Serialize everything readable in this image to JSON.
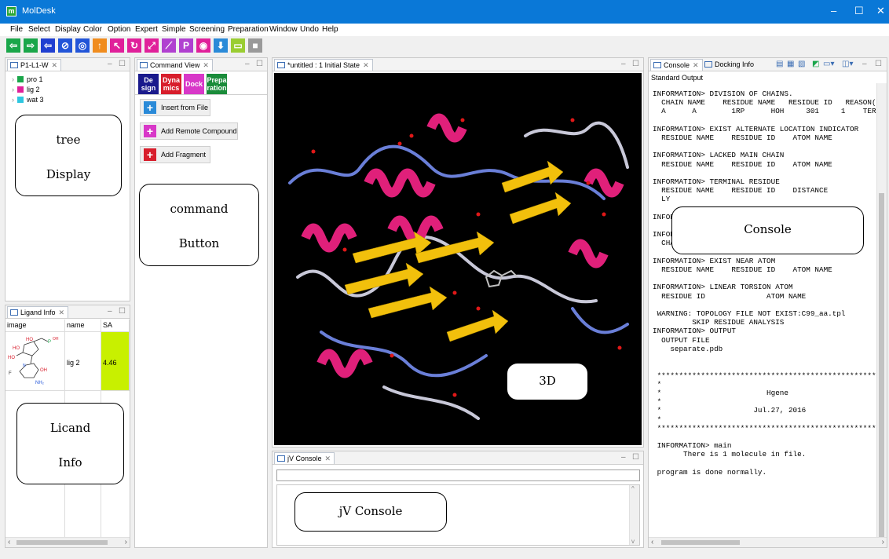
{
  "window": {
    "title": "MolDesk",
    "app_icon": "m",
    "minimize": "–",
    "maximize": "☐",
    "close": "✕"
  },
  "menu": [
    "File",
    "Select",
    "Display",
    "Color",
    "Option",
    "Expert",
    "Simple",
    "Screening",
    "Preparation",
    "Window",
    "Undo",
    "Help"
  ],
  "toolbar": {
    "buttons": [
      {
        "name": "back-arrow-icon",
        "glyph": "⇦",
        "color": "#1aa64a"
      },
      {
        "name": "forward-arrow-icon",
        "glyph": "⇨",
        "color": "#1aa64a"
      },
      {
        "name": "back-blue-icon",
        "glyph": "⇦",
        "color": "#1f3fd1"
      },
      {
        "name": "cancel-icon",
        "glyph": "⊘",
        "color": "#2255d8"
      },
      {
        "name": "target-icon",
        "glyph": "◎",
        "color": "#2255d8"
      },
      {
        "name": "up-arrow-icon",
        "glyph": "↑",
        "color": "#f08c1e"
      },
      {
        "name": "select-cursor-icon",
        "glyph": "↖",
        "color": "#e0209a"
      },
      {
        "name": "rotate-icon",
        "glyph": "↻",
        "color": "#e0209a"
      },
      {
        "name": "expand-icon",
        "glyph": "⤢",
        "color": "#e0209a"
      },
      {
        "name": "feather-icon",
        "glyph": "⟋",
        "color": "#b040d0"
      },
      {
        "name": "ruler-icon",
        "glyph": "P",
        "color": "#b040d0"
      },
      {
        "name": "eye-icon",
        "glyph": "◉",
        "color": "#e0209a"
      },
      {
        "name": "download-icon",
        "glyph": "⬇",
        "color": "#2a8ad8"
      },
      {
        "name": "monitor-icon",
        "glyph": "▭",
        "color": "#9acd32"
      },
      {
        "name": "stop-icon",
        "glyph": "■",
        "color": "#9a9a9a"
      }
    ]
  },
  "tree_panel": {
    "tab": "P1-L1-W",
    "items": [
      {
        "label": "pro 1",
        "color": "#1aa64a"
      },
      {
        "label": "lig 2",
        "color": "#e0209a"
      },
      {
        "label": "wat 3",
        "color": "#2ec6e0"
      }
    ],
    "callout": [
      "tree",
      "Display"
    ]
  },
  "ligand_panel": {
    "tab": "Ligand Info",
    "columns": [
      "image",
      "name",
      "SA"
    ],
    "rows": [
      {
        "name": "lig 2",
        "sa": "4.46"
      }
    ],
    "callout": [
      "Licand",
      "Info"
    ]
  },
  "command_panel": {
    "tab": "Command View",
    "subtabs": [
      {
        "label1": "De",
        "label2": "sign",
        "color": "#1a1a8c"
      },
      {
        "label1": "Dyna",
        "label2": "mics",
        "color": "#d81e2c"
      },
      {
        "label1": "Dock",
        "label2": "",
        "color": "#d838c8"
      },
      {
        "label1": "Prepa",
        "label2": "ration",
        "color": "#1a8c3a"
      }
    ],
    "buttons": [
      {
        "label": "Insert from File",
        "color": "#2a8ad8"
      },
      {
        "label": "Add Remote Compound",
        "color": "#d838c8"
      },
      {
        "label": "Add Fragment",
        "color": "#d81e2c"
      }
    ],
    "callout": [
      "command",
      "Button"
    ]
  },
  "viewer_panel": {
    "tab": "*untitled : 1 Initial State",
    "callout": "3D"
  },
  "jv_panel": {
    "tab": "jV Console",
    "callout": "jV Console"
  },
  "console_panel": {
    "tab": "Console",
    "tab2": "Docking Info",
    "header": "Standard Output",
    "text": "INFORMATION> DIVISION OF CHAINS.\n  CHAIN NAME    RESIDUE NAME   RESIDUE ID   REASON(EXC\n  A      A        1RP      HOH     301     1    TERMINAL (\n\nINFORMATION> EXIST ALTERNATE LOCATION INDICATOR\n  RESIDUE NAME    RESIDUE ID    ATOM NAME\n\nINFORMATION> LACKED MAIN CHAIN\n  RESIDUE NAME    RESIDUE ID    ATOM NAME\n\nINFORMATION> TERMINAL RESIDUE\n  RESIDUE NAME    RESIDUE ID    DISTANCE\n  LY\n\nINFOR\n\nINFOR\n  CHAIN ID   RESIDUE NAME    RESID ID\n\nINFORMATION> EXIST NEAR ATOM\n  RESIDUE NAME    RESIDUE ID    ATOM NAME\n\nINFORMATION> LINEAR TORSION ATOM\n  RESIDUE ID              ATOM NAME\n\n WARNING: TOPOLOGY FILE NOT EXIST:C99_aa.tpl\n         SKIP RESIDUE ANALYSIS\nINFORMATION> OUTPUT\n  OUTPUT FILE\n    separate.pdb\n\n\n ************************************************************\n *                                                          *\n *                        Hgene                             *\n *                                                          *\n *                     Jul.27, 2016                         *\n *                                                          *\n ************************************************************\n\n INFORMATION> main\n       There is 1 molecule in file.\n\n program is done normally.",
    "callout": "Console"
  }
}
